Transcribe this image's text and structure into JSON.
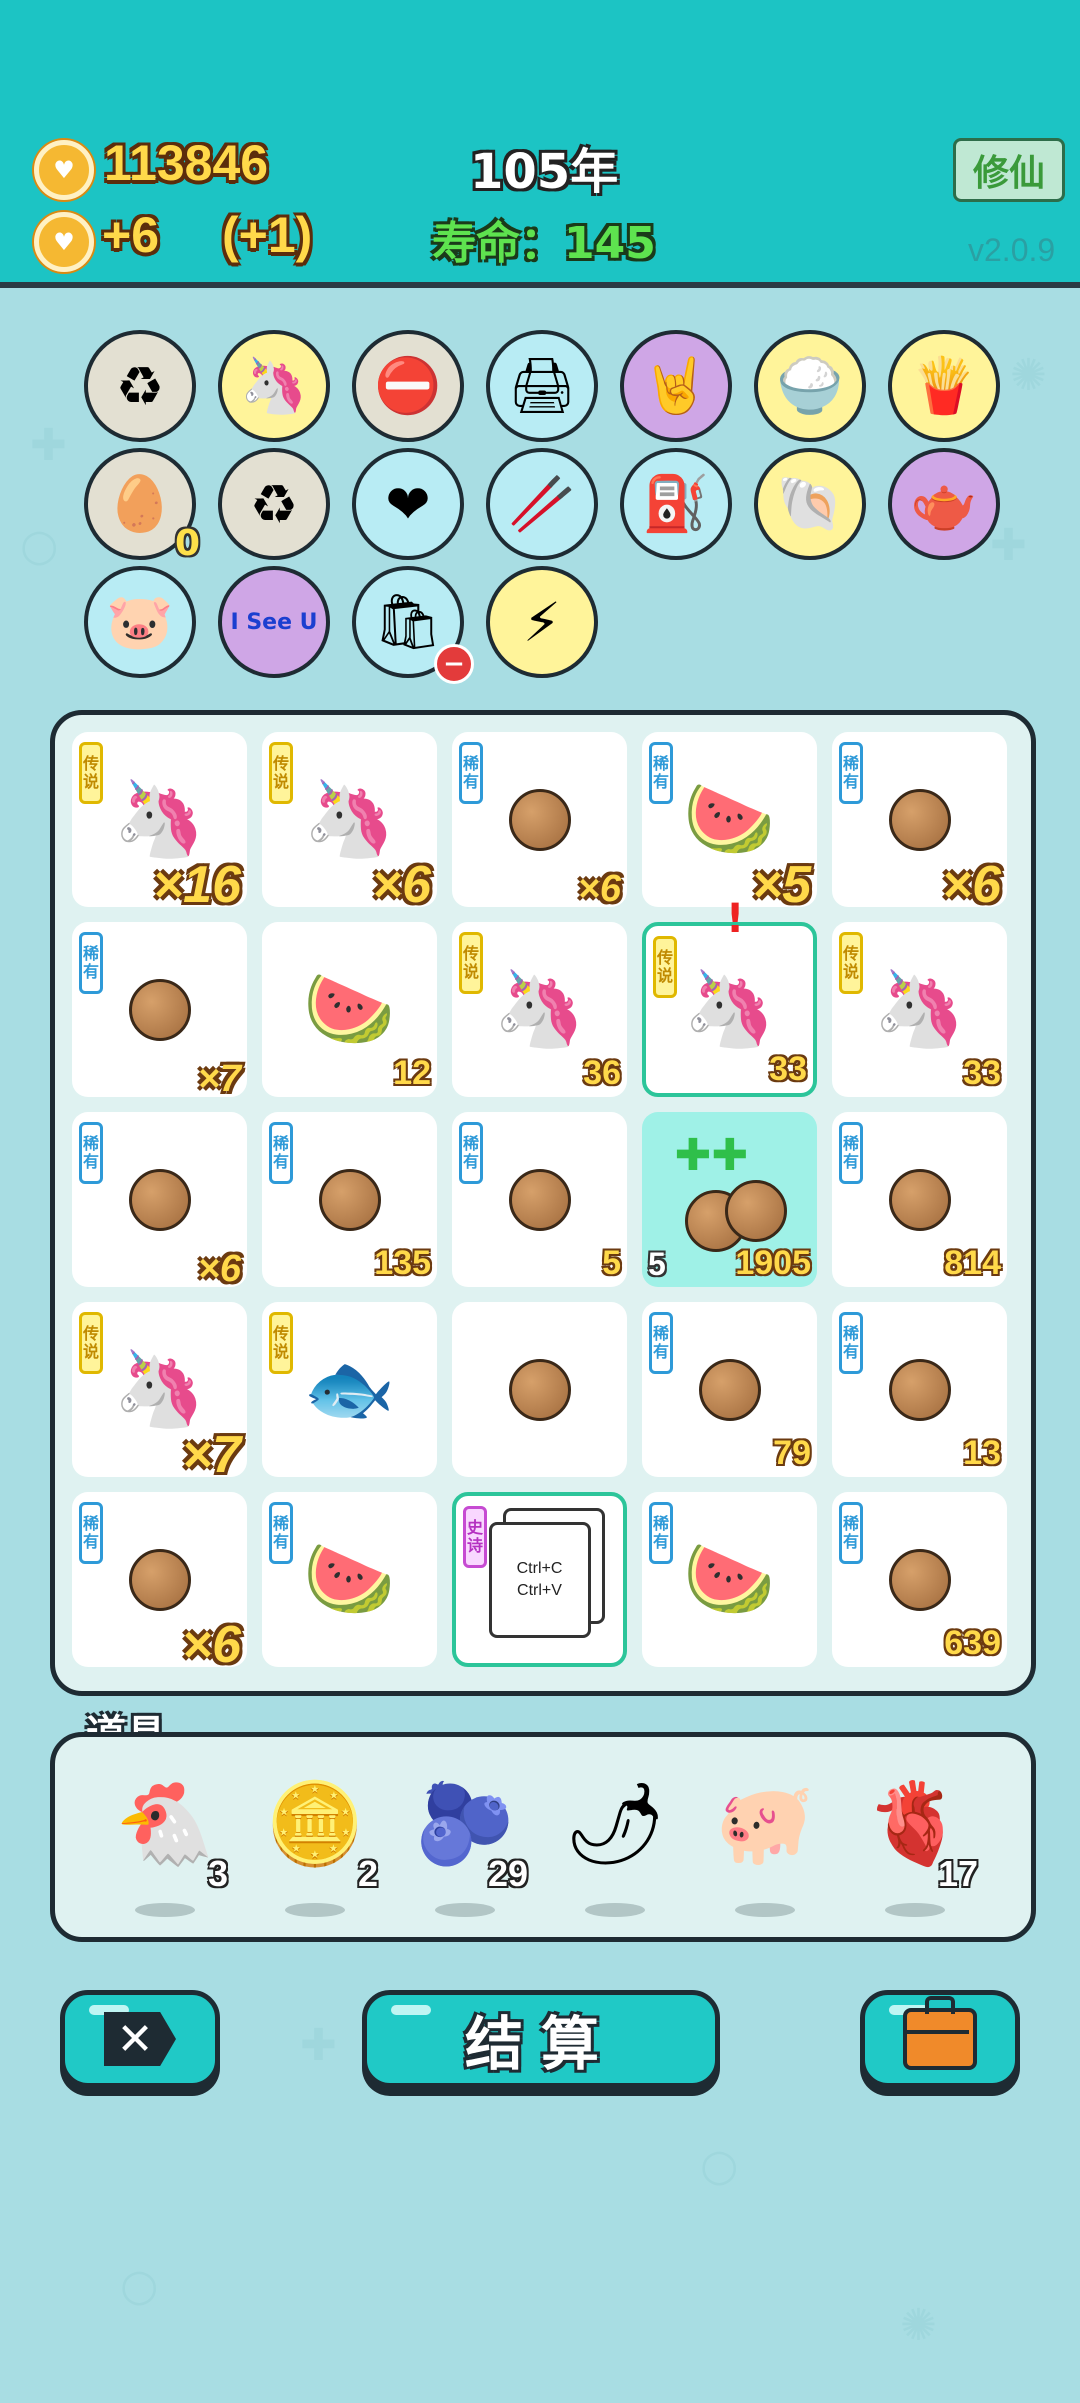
{
  "header": {
    "coins": "113846",
    "income": "+6",
    "income_bonus": "(+1)",
    "year": "105年",
    "lifespan_label": "寿命：",
    "lifespan_value": "145",
    "cultivate_button": "修仙",
    "version": "v2.0.9"
  },
  "relics": [
    {
      "icon": "recycle-icon",
      "glyph": "♻",
      "bg": "#e3e0d2"
    },
    {
      "icon": "unicorn-icon",
      "glyph": "🦄",
      "bg": "#fff49a"
    },
    {
      "icon": "no-entry-icon",
      "glyph": "⛔",
      "bg": "#e3e0d2"
    },
    {
      "icon": "printer-icon",
      "glyph": "🖨",
      "bg": "#b8ecf4"
    },
    {
      "icon": "rock-hand-icon",
      "glyph": "🤘",
      "bg": "#cfa6e6"
    },
    {
      "icon": "rice-bowl-icon",
      "glyph": "🍚",
      "bg": "#fff49a"
    },
    {
      "icon": "fries-icon",
      "glyph": "🍟",
      "bg": "#fff49a"
    },
    {
      "icon": "egg-tray-icon",
      "glyph": "🥚",
      "bg": "#e3e0d2",
      "count": "0"
    },
    {
      "icon": "recycle-icon",
      "glyph": "♻",
      "bg": "#e3e0d2"
    },
    {
      "icon": "blood-bag-icon",
      "glyph": "❤",
      "bg": "#b8ecf4"
    },
    {
      "icon": "chopsticks-icon",
      "glyph": "🥢",
      "bg": "#b8ecf4"
    },
    {
      "icon": "pump-icon",
      "glyph": "⛽",
      "bg": "#b8ecf4"
    },
    {
      "icon": "shell-icon",
      "glyph": "🐚",
      "bg": "#fff49a"
    },
    {
      "icon": "gravy-boat-icon",
      "glyph": "🫖",
      "bg": "#cfa6e6"
    },
    {
      "icon": "piggy-bank-icon",
      "glyph": "🐷",
      "bg": "#b8ecf4"
    },
    {
      "icon": "i-see-u-icon",
      "text": "I See U",
      "bg": "#cfa6e6"
    },
    {
      "icon": "trash-bag-icon",
      "glyph": "🛍",
      "bg": "#b8ecf4"
    },
    {
      "icon": "lightning-icon",
      "glyph": "⚡",
      "bg": "#fff49a"
    }
  ],
  "board": {
    "cells": [
      {
        "tag": "传说",
        "rarity": "legend",
        "icon": "unicorn",
        "mult": "×16"
      },
      {
        "tag": "传说",
        "rarity": "legend",
        "icon": "unicorn",
        "mult": "×6"
      },
      {
        "tag": "稀有",
        "rarity": "rare",
        "icon": "seed",
        "mult_sm": "×6"
      },
      {
        "tag": "稀有",
        "rarity": "rare",
        "icon": "watermelon",
        "mult": "×5"
      },
      {
        "tag": "稀有",
        "rarity": "rare",
        "icon": "seed",
        "mult": "×6"
      },
      {
        "tag": "稀有",
        "rarity": "rare",
        "icon": "seed",
        "mult_sm": "×7"
      },
      {
        "icon": "watermelon-slice",
        "num": "12"
      },
      {
        "tag": "传说",
        "rarity": "legend",
        "icon": "unicorn",
        "num": "36"
      },
      {
        "tag": "传说",
        "rarity": "legend",
        "icon": "unicorn",
        "num": "33",
        "highlight": true,
        "alert": "!"
      },
      {
        "tag": "传说",
        "rarity": "legend",
        "icon": "unicorn",
        "num": "33"
      },
      {
        "tag": "稀有",
        "rarity": "rare",
        "icon": "seed",
        "mult_sm": "×6"
      },
      {
        "tag": "稀有",
        "rarity": "rare",
        "icon": "seed",
        "num": "135"
      },
      {
        "tag": "稀有",
        "rarity": "rare",
        "icon": "seed",
        "num": "5"
      },
      {
        "icon": "growing-seeds",
        "num": "1905",
        "left_num": "5",
        "teal": true
      },
      {
        "tag": "稀有",
        "rarity": "rare",
        "icon": "seed",
        "num": "814"
      },
      {
        "tag": "传说",
        "rarity": "legend",
        "icon": "unicorn",
        "mult": "×7"
      },
      {
        "tag": "传说",
        "rarity": "legend",
        "icon": "koi-fish"
      },
      {
        "icon": "seed"
      },
      {
        "tag": "稀有",
        "rarity": "rare",
        "icon": "seed",
        "num": "79"
      },
      {
        "tag": "稀有",
        "rarity": "rare",
        "icon": "seed",
        "num": "13"
      },
      {
        "tag": "稀有",
        "rarity": "rare",
        "icon": "seed",
        "mult": "×6"
      },
      {
        "tag": "稀有",
        "rarity": "rare",
        "icon": "watermelon"
      },
      {
        "tag": "史诗",
        "rarity": "epic",
        "icon": "ctrl-cv",
        "ctrl_text": "Ctrl+C\nCtrl+V",
        "highlight": true
      },
      {
        "tag": "稀有",
        "rarity": "rare",
        "icon": "watermelon"
      },
      {
        "tag": "稀有",
        "rarity": "rare",
        "icon": "seed",
        "num": "639"
      }
    ]
  },
  "items": {
    "label": "道具",
    "list": [
      {
        "icon": "chicken-icon",
        "glyph": "🐔",
        "count": "3"
      },
      {
        "icon": "coin-icon",
        "glyph": "🪙",
        "count": "2"
      },
      {
        "icon": "blueberry-icon",
        "glyph": "🫐",
        "count": "29"
      },
      {
        "icon": "chili-icon",
        "glyph": "🌶",
        "count": ""
      },
      {
        "icon": "piggy-bank-icon",
        "glyph": "🐖",
        "count": ""
      },
      {
        "icon": "liver-icon",
        "glyph": "🫀",
        "count": "17"
      }
    ]
  },
  "buttons": {
    "close": "✕",
    "settle": "结算"
  }
}
